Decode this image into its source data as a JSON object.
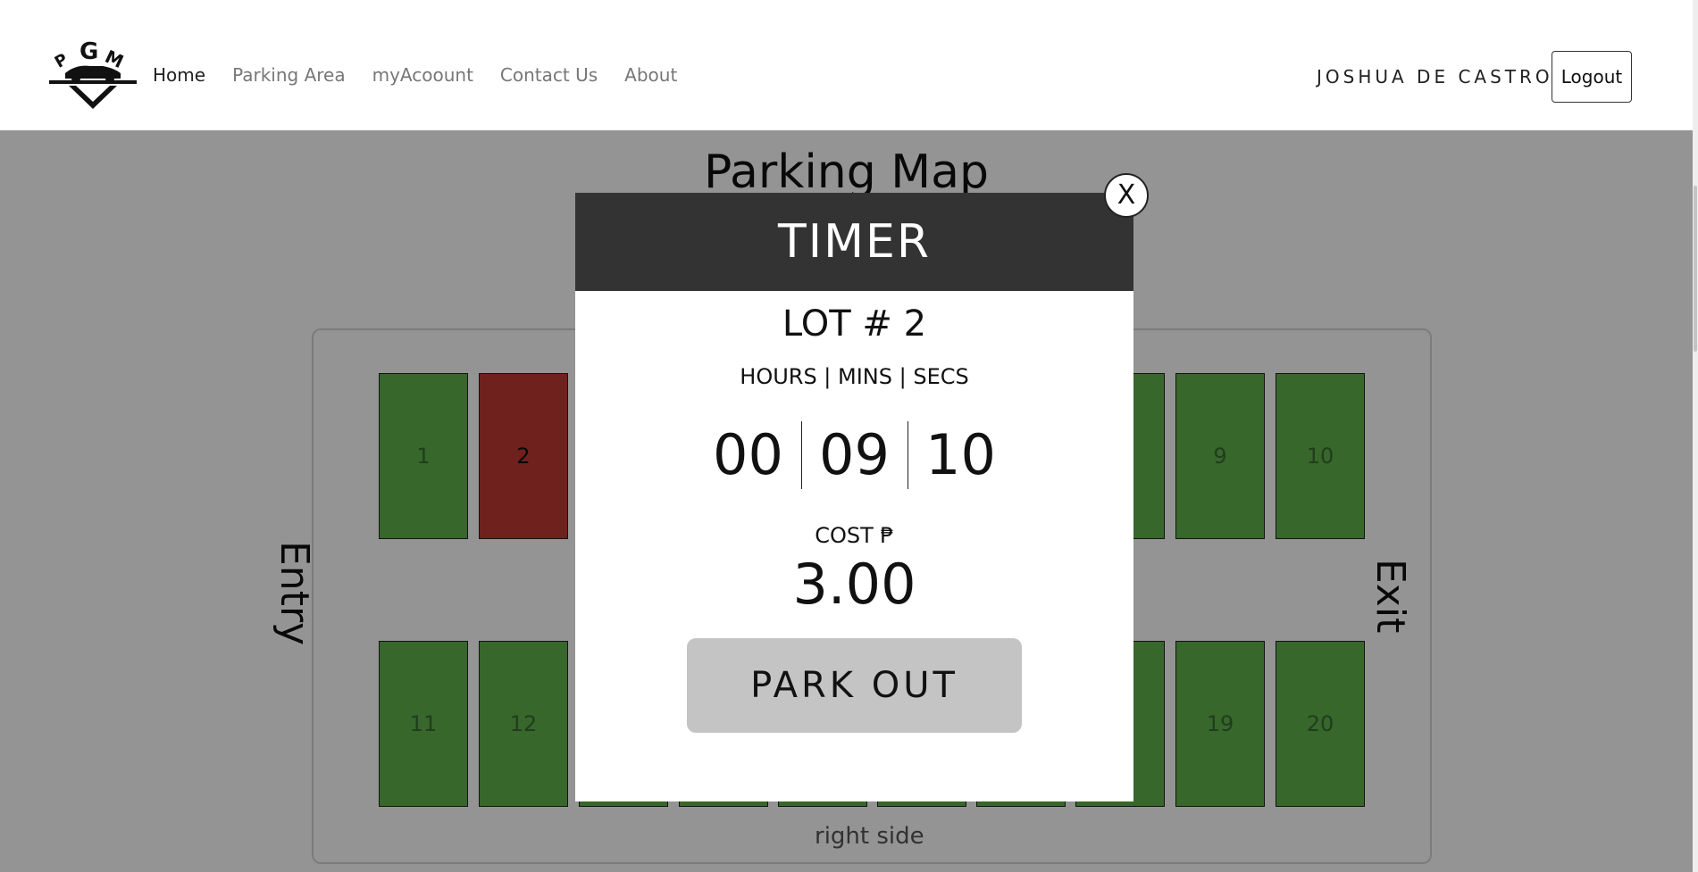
{
  "nav": {
    "logo_text": "PGM",
    "links": [
      "Home",
      "Parking Area",
      "myAcoount",
      "Contact Us",
      "About"
    ],
    "user_name": "JOSHUA DE CASTRO",
    "logout_label": "Logout"
  },
  "parking_map": {
    "title": "Parking Map",
    "entry_label": "Entry",
    "exit_label": "Exit",
    "right_side_label": "right side",
    "slots_top": [
      {
        "number": "1",
        "status": "available"
      },
      {
        "number": "2",
        "status": "occupied"
      },
      {
        "number": "9",
        "status": "available"
      },
      {
        "number": "10",
        "status": "available"
      }
    ],
    "slots_bottom": [
      {
        "number": "11",
        "status": "available"
      },
      {
        "number": "12",
        "status": "available"
      },
      {
        "number": "19",
        "status": "available"
      },
      {
        "number": "20",
        "status": "available"
      }
    ],
    "colors": {
      "available": "#5fb24a",
      "occupied": "#bd3a33"
    }
  },
  "timer_modal": {
    "title": "TIMER",
    "lot_label": "LOT # 2",
    "units_label": "HOURS | MINS | SECS",
    "hours": "00",
    "mins": "09",
    "secs": "10",
    "cost_label": "COST ₱",
    "cost_value": "3.00",
    "park_out_label": "PARK OUT",
    "close_label": "X"
  }
}
